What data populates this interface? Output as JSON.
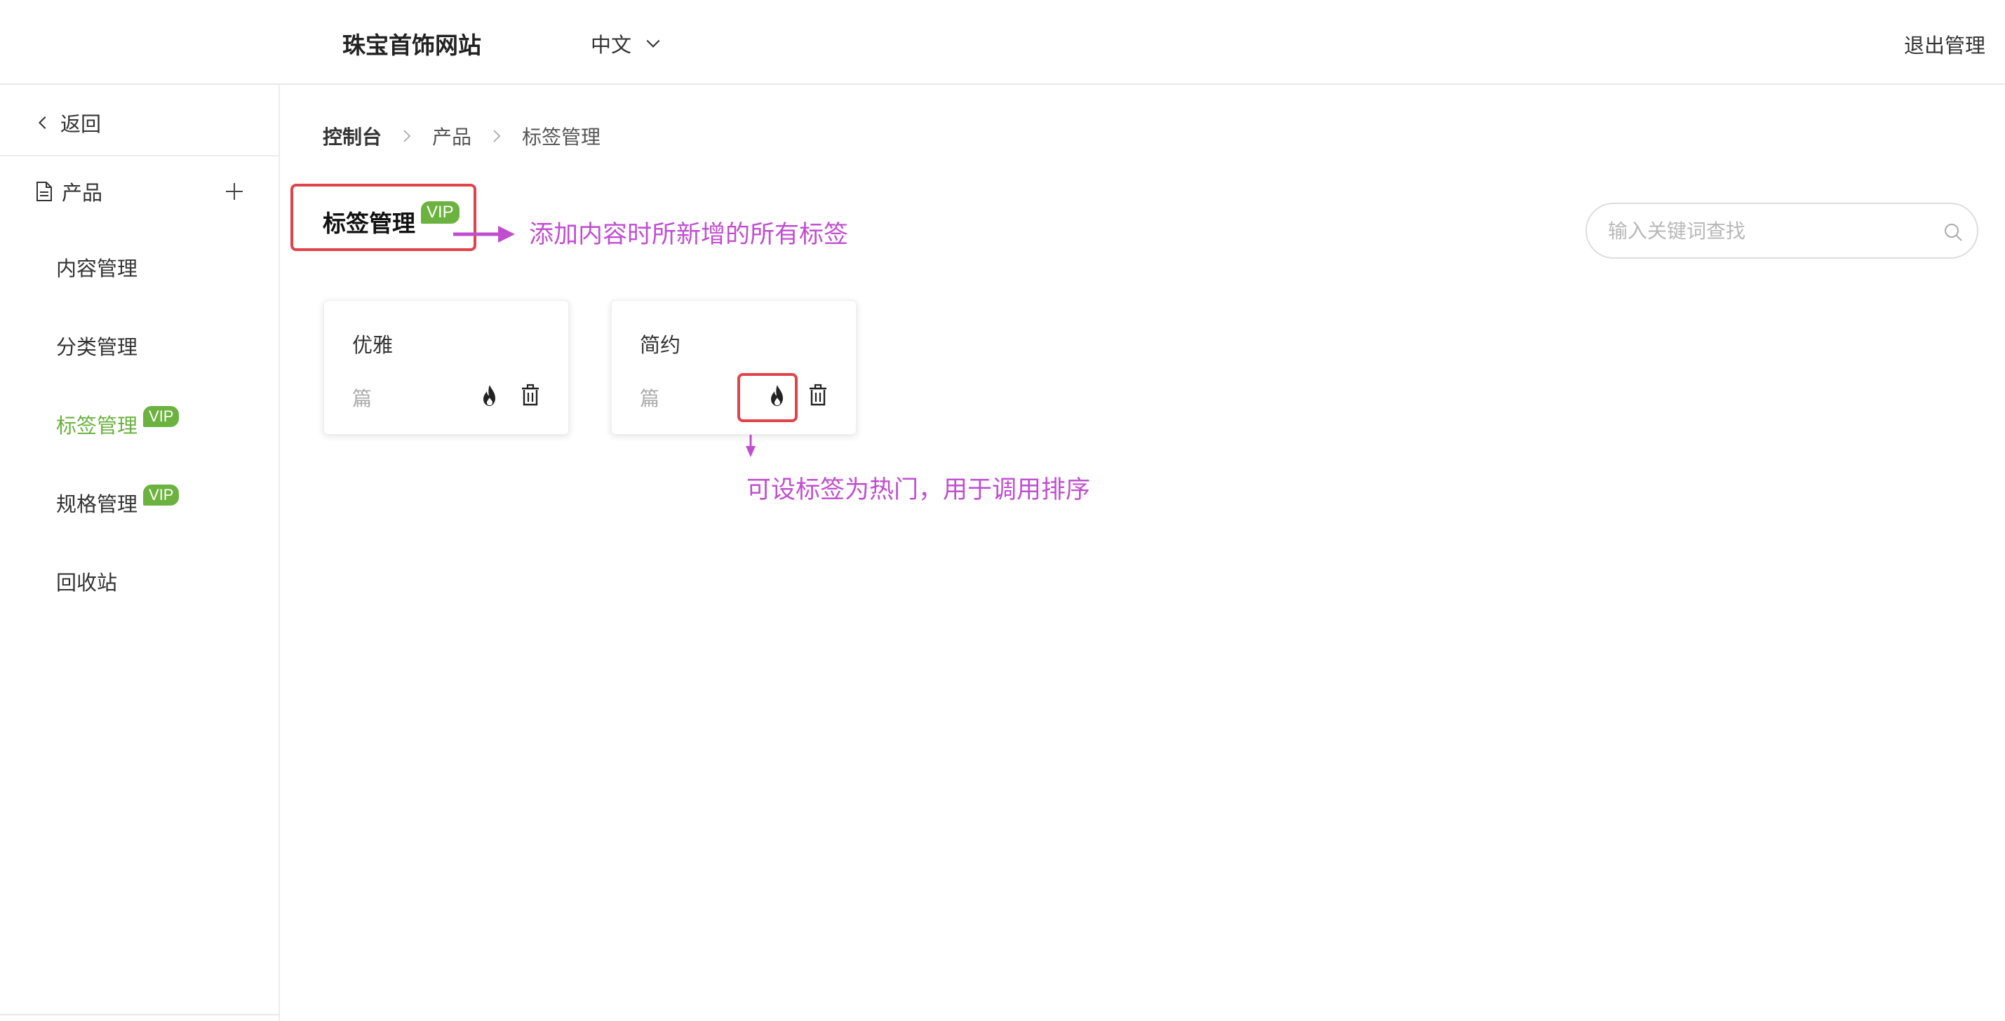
{
  "header": {
    "site_title": "珠宝首饰网站",
    "language": "中文",
    "logout_label": "退出管理"
  },
  "sidebar": {
    "back_label": "返回",
    "section_label": "产品",
    "items": [
      {
        "label": "内容管理",
        "vip": false,
        "active": false
      },
      {
        "label": "分类管理",
        "vip": false,
        "active": false
      },
      {
        "label": "标签管理",
        "vip": true,
        "active": true
      },
      {
        "label": "规格管理",
        "vip": true,
        "active": false
      },
      {
        "label": "回收站",
        "vip": false,
        "active": false
      }
    ],
    "vip_label": "VIP"
  },
  "breadcrumb": [
    "控制台",
    "产品",
    "标签管理"
  ],
  "page": {
    "title": "标签管理",
    "vip_label": "VIP"
  },
  "annotations": {
    "title_note": "添加内容时所新增的所有标签",
    "hot_note": "可设标签为热门，用于调用排序"
  },
  "search": {
    "placeholder": "输入关键词查找"
  },
  "tags": [
    {
      "name": "优雅",
      "count_label": "篇"
    },
    {
      "name": "简约",
      "count_label": "篇"
    }
  ],
  "colors": {
    "accent_green": "#6bb23f",
    "annotation_purple": "#c04fd0",
    "highlight_red": "#e0434a"
  }
}
